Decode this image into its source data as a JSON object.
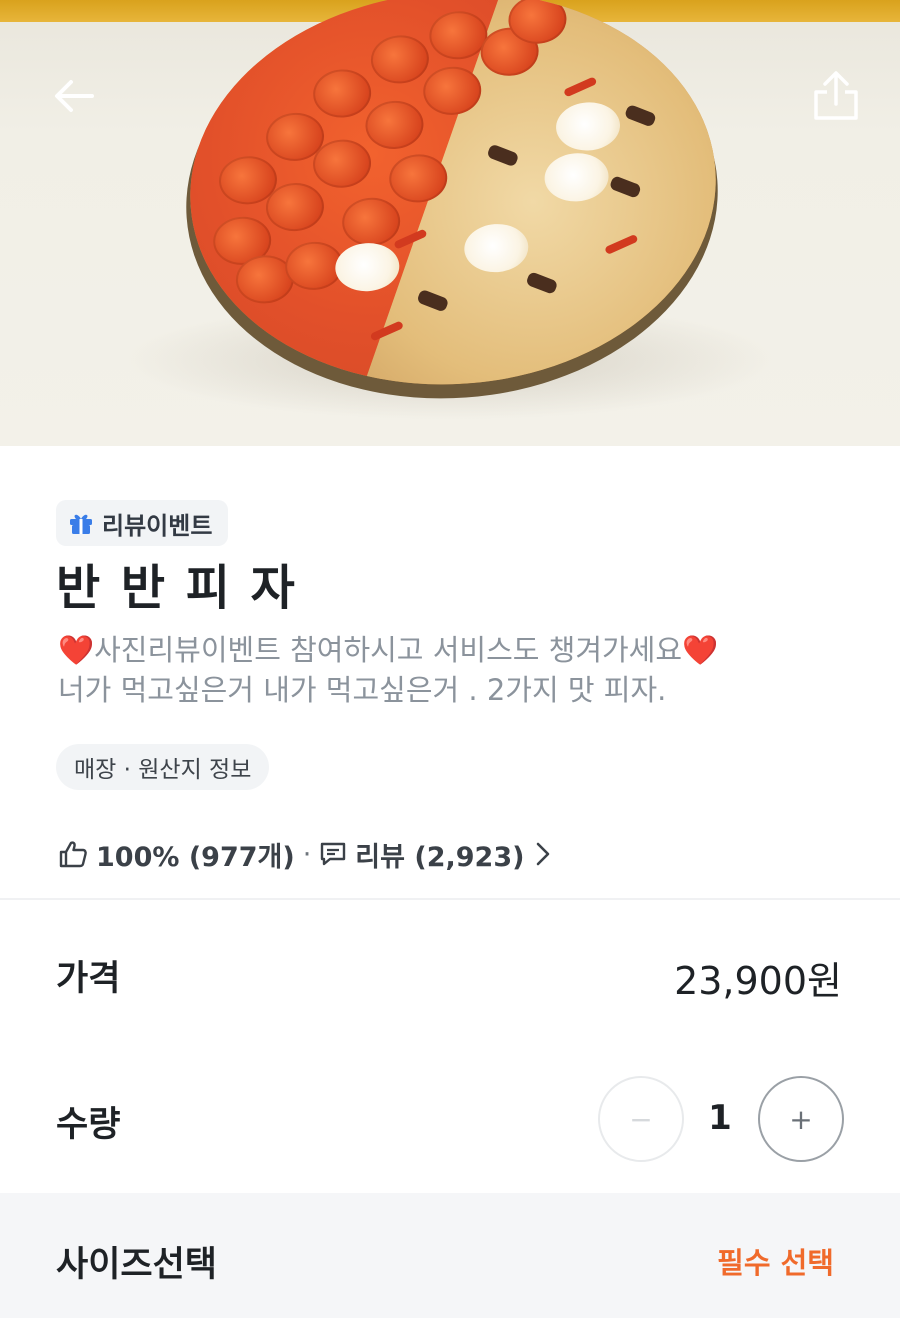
{
  "hero": {
    "image_alt": "pizza-photo",
    "icons": {
      "back": "arrow-left-icon",
      "share": "share-icon"
    }
  },
  "badge": {
    "icon": "gift-icon",
    "label": "리뷰이벤트"
  },
  "product": {
    "name": "반 반 피 자",
    "desc_line1_heart_left": "❤️",
    "desc_line1_text": "사진리뷰이벤트 참여하시고 서비스도 챙겨가세요",
    "desc_line1_heart_right": "❤️",
    "desc_line2": "너가 먹고싶은거 내가 먹고싶은거 . 2가지 맛 피자."
  },
  "info_chip": {
    "label": "매장 · 원산지 정보"
  },
  "stats": {
    "like_icon": "thumbs-up-icon",
    "like_text": "100% (977개)",
    "separator": "·",
    "review_icon": "message-icon",
    "review_text": "리뷰 (2,923)",
    "chevron_icon": "chevron-right-icon"
  },
  "price": {
    "label": "가격",
    "value": "23,900원"
  },
  "quantity": {
    "label": "수량",
    "value": "1",
    "minus": "−",
    "plus": "+"
  },
  "size": {
    "label": "사이즈선택",
    "required": "필수 선택"
  },
  "colors": {
    "accent": "#f06a2b",
    "heart": "#e5242b",
    "badge_icon": "#3a7de8"
  }
}
